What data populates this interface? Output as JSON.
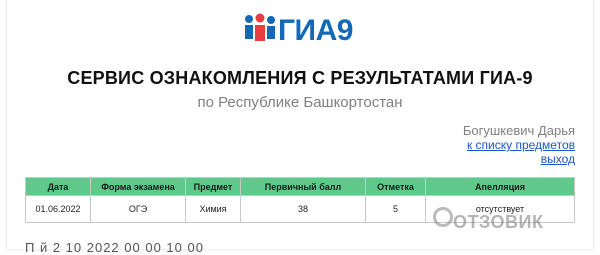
{
  "logo": {
    "text": "ГИА9",
    "icon": "people-icon",
    "brand_color": "#1469b6",
    "accent_color": "#e63f42"
  },
  "header": {
    "title": "СЕРВИС ОЗНАКОМЛЕНИЯ С РЕЗУЛЬТАТАМИ ГИА-9",
    "subtitle": "по Республике Башкортостан"
  },
  "student": {
    "name": "Богушкевич Дарья",
    "back_link": "к списку предметов",
    "logout_link": "выход"
  },
  "results_table": {
    "header_color": "#5fc98a",
    "columns": [
      "Дата",
      "Форма экзамена",
      "Предмет",
      "Первичный балл",
      "Отметка",
      "Апелляция"
    ],
    "rows": [
      {
        "date": "01.06.2022",
        "form": "ОГЭ",
        "subject": "Химия",
        "primary_score": "38",
        "grade": "5",
        "appeal": "отсутствует"
      }
    ]
  },
  "footer_partial": "П                          й        2  10   2022       00 00   10 00",
  "watermark": "ОТЗОВИК"
}
